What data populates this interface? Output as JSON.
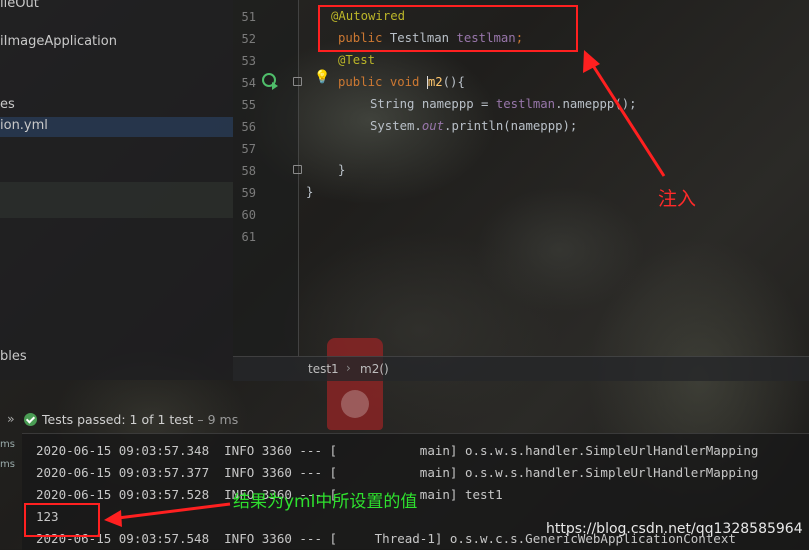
{
  "sidebar": {
    "items": [
      {
        "label": "ileOut"
      },
      {
        "label": "iImageApplication"
      },
      {
        "label": "es"
      },
      {
        "label": "ion.yml"
      },
      {
        "label": "bles"
      }
    ]
  },
  "editor": {
    "line_numbers": [
      "51",
      "52",
      "53",
      "54",
      "55",
      "56",
      "57",
      "58",
      "59",
      "60",
      "61"
    ],
    "lines": {
      "l51": "@Autowired",
      "l52_kw": "public ",
      "l52_type": "Testlman ",
      "l52_field": "testlman",
      "l52_end": ";",
      "l53": "@Test",
      "l54_kw": "public void ",
      "l54_method": "m2",
      "l54_end": "(){",
      "l55_a": "String nameppp = ",
      "l55_field": "testlman",
      "l55_b": ".nameppp();",
      "l56_a": "System.",
      "l56_out": "out",
      "l56_b": ".println(nameppp);",
      "l58": "}",
      "l59": "}"
    }
  },
  "breadcrumb": {
    "class": "test1",
    "sep": "›",
    "method": "m2()"
  },
  "run_panel": {
    "chevrons": "»",
    "status_prefix": "Tests passed: ",
    "status_count": "1",
    "status_suffix": " of 1 test",
    "status_time": " – 9 ms",
    "side_ms_1": "ms",
    "side_ms_2": "ms"
  },
  "console": {
    "lines": [
      "2020-06-15 09:03:57.348  INFO 3360 --- [           main] o.s.w.s.handler.SimpleUrlHandlerMapping",
      "2020-06-15 09:03:57.377  INFO 3360 --- [           main] o.s.w.s.handler.SimpleUrlHandlerMapping",
      "2020-06-15 09:03:57.528  INFO 3360 --- [           main] test1",
      "123",
      "2020-06-15 09:03:57.548  INFO 3360 --- [     Thread-1] o.s.w.c.s.GenericWebApplicationContext"
    ]
  },
  "annotations": {
    "inject": "注入",
    "result": "结果为yml中所设置的值",
    "watermark": "https://blog.csdn.net/qq1328585964"
  },
  "colors": {
    "annotation_red": "#ff2020",
    "annotation_green": "#2ee02e",
    "passed_green": "#4a9c54"
  }
}
